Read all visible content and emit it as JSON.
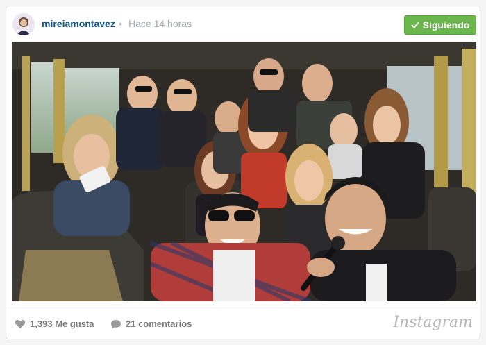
{
  "post": {
    "username": "mireiamontavez",
    "separator": "•",
    "time": "Hace 14 horas",
    "follow_label": "Siguiendo",
    "likes": "1,393 Me gusta",
    "comments": "21 comentarios",
    "brand": "Instagram"
  },
  "icons": {
    "check": "check-icon",
    "heart": "heart-icon",
    "comment": "comment-icon"
  },
  "colors": {
    "username": "#125688",
    "follow_button": "#6bb64c",
    "meta_text": "#a5a7aa"
  }
}
